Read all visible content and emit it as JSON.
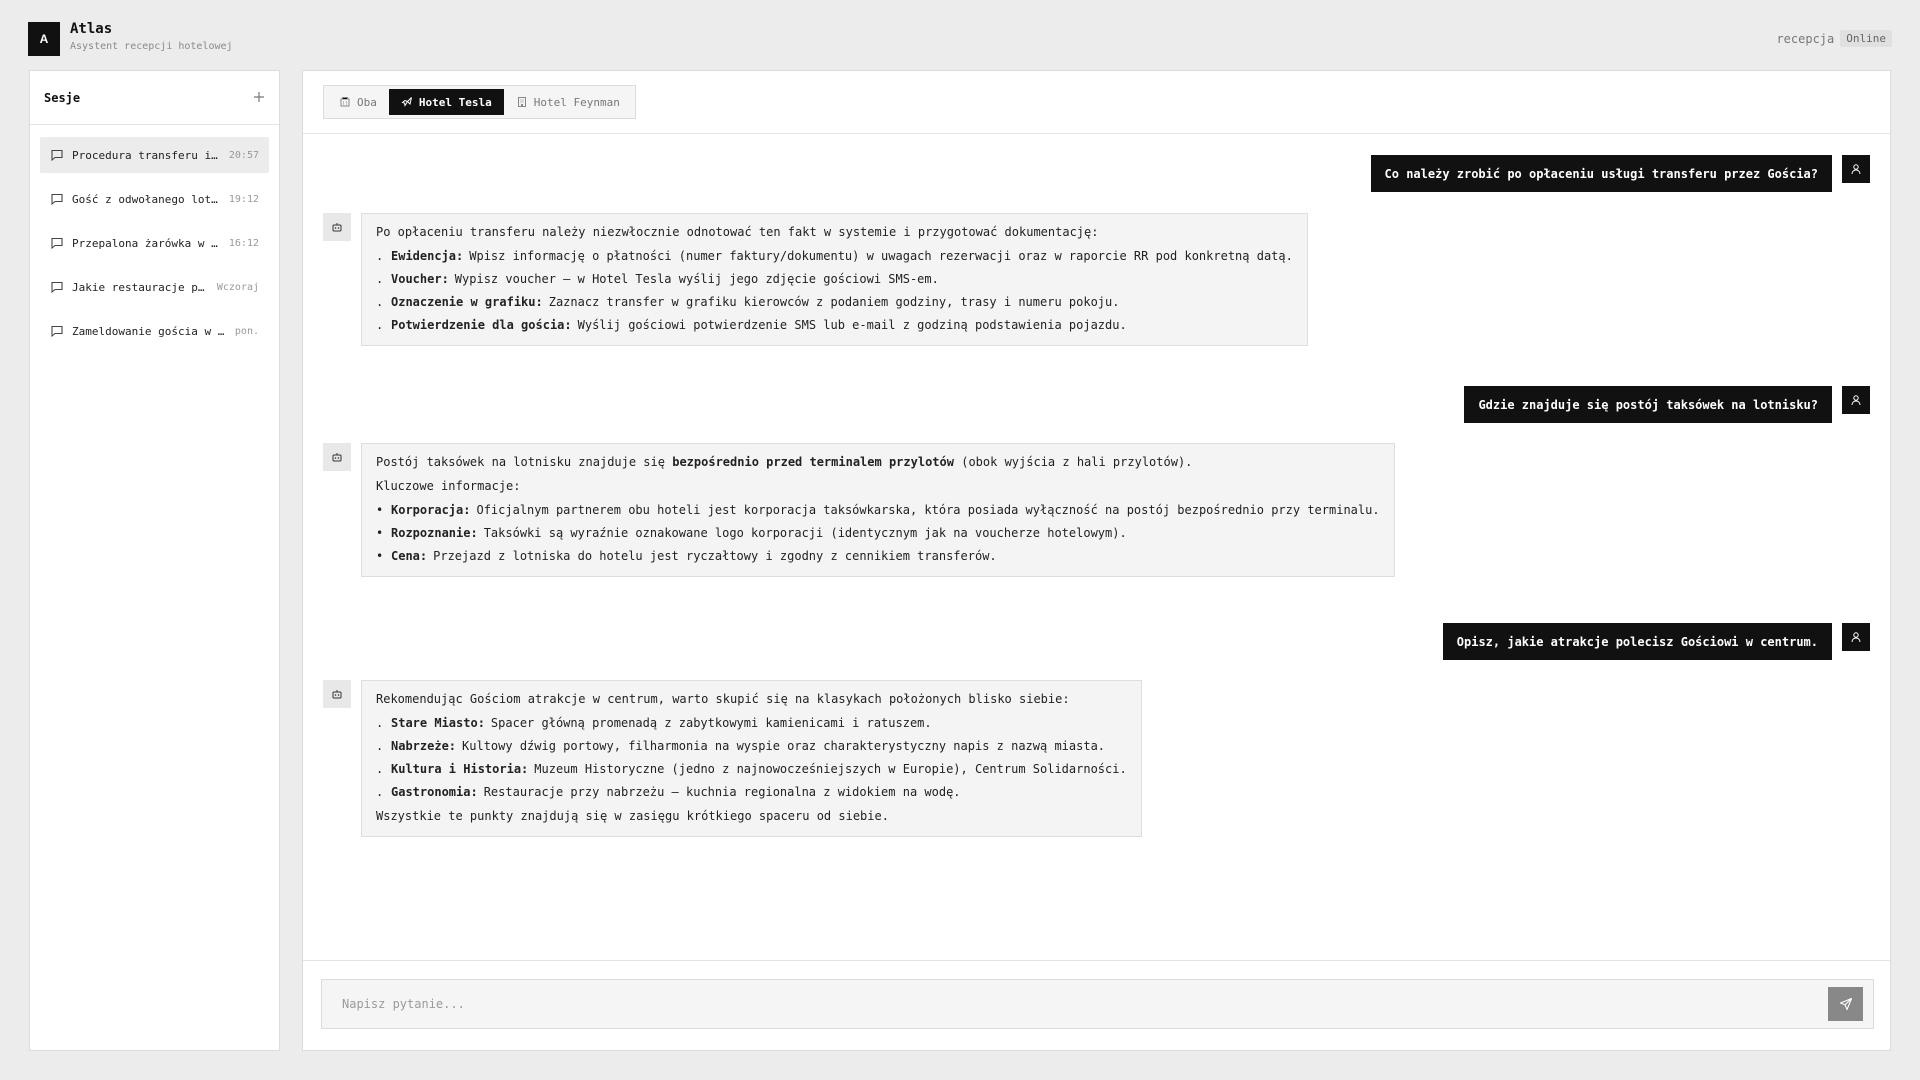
{
  "app": {
    "logo_letter": "A",
    "title": "Atlas",
    "subtitle": "Asystent recepcji hotelowej",
    "user": "recepcja",
    "status": "Online"
  },
  "sidebar": {
    "title": "Sesje",
    "add_icon": "plus-icon",
    "sessions": [
      {
        "title": "Procedura transferu i …",
        "time": "20:57",
        "active": true
      },
      {
        "title": "Gość z odwołanego lotu…",
        "time": "19:12",
        "active": false
      },
      {
        "title": "Przepalona żarówka w r…",
        "time": "16:12",
        "active": false
      },
      {
        "title": "Jakie restauracje po…",
        "time": "Wczoraj",
        "active": false
      },
      {
        "title": "Zameldowanie gościa w H…",
        "time": "pon.",
        "active": false
      }
    ]
  },
  "tabs": [
    {
      "label": "Oba",
      "icon": "building-icon",
      "active": false
    },
    {
      "label": "Hotel Tesla",
      "icon": "plane-icon",
      "active": true
    },
    {
      "label": "Hotel Feynman",
      "icon": "hotel-icon",
      "active": false
    }
  ],
  "messages": {
    "q1": "Co należy zrobić po opłaceniu usługi transferu przez Gościa?",
    "a1": {
      "intro": "Po opłaceniu transferu należy niezwłocznie odnotować ten fakt w systemie i przygotować dokumentację:",
      "items": [
        {
          "bold": "Ewidencja:",
          "text": "Wpisz informację o płatności (numer faktury/dokumentu) w uwagach rezerwacji oraz w raporcie RR pod konkretną datą."
        },
        {
          "bold": "Voucher:",
          "text": "Wypisz voucher — w Hotel Tesla wyślij jego zdjęcie gościowi SMS-em."
        },
        {
          "bold": "Oznaczenie w grafiku:",
          "text": "Zaznacz transfer w grafiku kierowców z podaniem godziny, trasy i numeru pokoju."
        },
        {
          "bold": "Potwierdzenie dla gościa:",
          "text": "Wyślij gościowi potwierdzenie SMS lub e-mail z godziną podstawienia pojazdu."
        }
      ]
    },
    "q2": "Gdzie znajduje się postój taksówek na lotnisku?",
    "a2": {
      "intro_pre": "Postój taksówek na lotnisku znajduje się",
      "intro_bold": "bezpośrednio przed terminalem przylotów",
      "intro_post": "(obok wyjścia z hali przylotów).",
      "lead": "Kluczowe informacje:",
      "items": [
        {
          "bold": "Korporacja:",
          "text": "Oficjalnym partnerem obu hoteli jest korporacja taksówkarska, która posiada wyłączność na postój bezpośrednio przy terminalu."
        },
        {
          "bold": "Rozpoznanie:",
          "text": "Taksówki są wyraźnie oznakowane logo korporacji (identycznym jak na voucherze hotelowym)."
        },
        {
          "bold": "Cena:",
          "text": "Przejazd z lotniska do hotelu jest ryczałtowy i zgodny z cennikiem transferów."
        }
      ]
    },
    "q3": "Opisz, jakie atrakcje polecisz Gościowi w centrum.",
    "a3": {
      "intro": "Rekomendując Gościom atrakcje w centrum, warto skupić się na klasykach położonych blisko siebie:",
      "items": [
        {
          "bold": "Stare Miasto:",
          "text": "Spacer główną promenadą z zabytkowymi kamienicami i ratuszem."
        },
        {
          "bold": "Nabrzeże:",
          "text": "Kultowy dźwig portowy, filharmonia na wyspie oraz charakterystyczny napis z nazwą miasta."
        },
        {
          "bold": "Kultura i Historia:",
          "text": "Muzeum Historyczne (jedno z najnowocześniejszych w Europie), Centrum Solidarności."
        },
        {
          "bold": "Gastronomia:",
          "text": "Restauracje przy nabrzeżu — kuchnia regionalna z widokiem na wodę."
        }
      ],
      "outro": "Wszystkie te punkty znajdują się w zasięgu krótkiego spaceru od siebie."
    }
  },
  "composer": {
    "placeholder": "Napisz pytanie...",
    "send_icon": "send-icon"
  },
  "colors": {
    "accent": "#111111",
    "background": "#ececec",
    "bubble_bot": "#f4f4f4",
    "send_button": "#888888"
  }
}
